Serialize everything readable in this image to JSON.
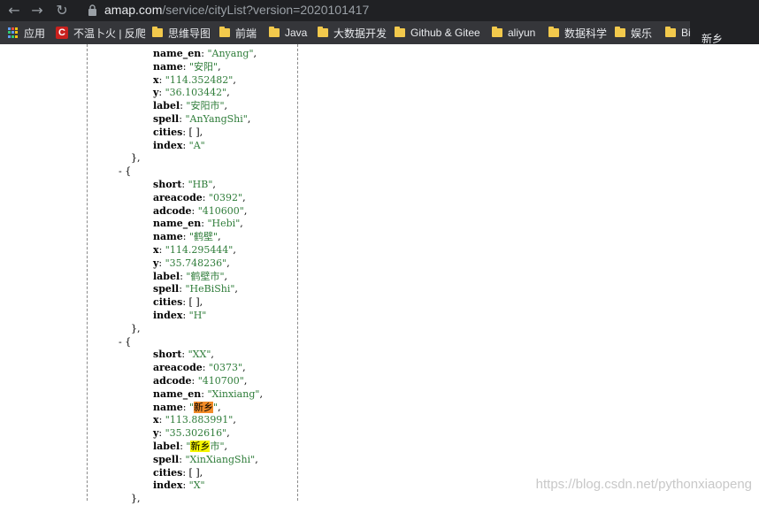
{
  "browser": {
    "url_host": "amap.com",
    "url_path": "/service/cityList?version=2020101417",
    "bookmarks": [
      {
        "label": "应用",
        "icon": "apps-grid-icon"
      },
      {
        "label": "不温卜火 | 反爬",
        "icon": "csdn-icon"
      },
      {
        "label": "思维导图",
        "icon": "folder-icon"
      },
      {
        "label": "前端",
        "icon": "folder-icon"
      },
      {
        "label": "Java",
        "icon": "folder-icon"
      },
      {
        "label": "大数据开发",
        "icon": "folder-icon"
      },
      {
        "label": "Github & Gitee",
        "icon": "folder-icon"
      },
      {
        "label": "aliyun",
        "icon": "folder-icon"
      },
      {
        "label": "数据科学",
        "icon": "folder-icon"
      },
      {
        "label": "娱乐",
        "icon": "folder-icon"
      },
      {
        "label": "Bi",
        "icon": "folder-icon"
      }
    ],
    "find_popup_text": "新乡"
  },
  "json_lines": [
    {
      "indent": 2,
      "key": "name_en",
      "value": "\"Anyang\""
    },
    {
      "indent": 2,
      "key": "name",
      "value": "\"安阳\""
    },
    {
      "indent": 2,
      "key": "x",
      "value": "\"114.352482\""
    },
    {
      "indent": 2,
      "key": "y",
      "value": "\"36.103442\""
    },
    {
      "indent": 2,
      "key": "label",
      "value": "\"安阳市\""
    },
    {
      "indent": 2,
      "key": "spell",
      "value": "\"AnYangShi\""
    },
    {
      "indent": 2,
      "key": "cities",
      "raw": "[ ],"
    },
    {
      "indent": 2,
      "key": "index",
      "value": "\"A\"",
      "last": true
    },
    {
      "indent": 1,
      "punct": "},"
    },
    {
      "indent": 0,
      "punct": "- {"
    },
    {
      "indent": 2,
      "key": "short",
      "value": "\"HB\""
    },
    {
      "indent": 2,
      "key": "areacode",
      "value": "\"0392\""
    },
    {
      "indent": 2,
      "key": "adcode",
      "value": "\"410600\""
    },
    {
      "indent": 2,
      "key": "name_en",
      "value": "\"Hebi\""
    },
    {
      "indent": 2,
      "key": "name",
      "value": "\"鹤壁\""
    },
    {
      "indent": 2,
      "key": "x",
      "value": "\"114.295444\""
    },
    {
      "indent": 2,
      "key": "y",
      "value": "\"35.748236\""
    },
    {
      "indent": 2,
      "key": "label",
      "value": "\"鹤壁市\""
    },
    {
      "indent": 2,
      "key": "spell",
      "value": "\"HeBiShi\""
    },
    {
      "indent": 2,
      "key": "cities",
      "raw": "[ ],"
    },
    {
      "indent": 2,
      "key": "index",
      "value": "\"H\"",
      "last": true
    },
    {
      "indent": 1,
      "punct": "},"
    },
    {
      "indent": 0,
      "punct": "- {"
    },
    {
      "indent": 2,
      "key": "short",
      "value": "\"XX\""
    },
    {
      "indent": 2,
      "key": "areacode",
      "value": "\"0373\""
    },
    {
      "indent": 2,
      "key": "adcode",
      "value": "\"410700\""
    },
    {
      "indent": 2,
      "key": "name_en",
      "value": "\"Xinxiang\""
    },
    {
      "indent": 2,
      "key": "name",
      "pre": "\"",
      "hl": "新乡",
      "hlclass": "hl-orange",
      "post": "\""
    },
    {
      "indent": 2,
      "key": "x",
      "value": "\"113.883991\""
    },
    {
      "indent": 2,
      "key": "y",
      "value": "\"35.302616\""
    },
    {
      "indent": 2,
      "key": "label",
      "pre": "\"",
      "hl": "新乡",
      "hlclass": "hl-yellow",
      "post": "市\""
    },
    {
      "indent": 2,
      "key": "spell",
      "value": "\"XinXiangShi\""
    },
    {
      "indent": 2,
      "key": "cities",
      "raw": "[ ],"
    },
    {
      "indent": 2,
      "key": "index",
      "value": "\"X\"",
      "last": true
    },
    {
      "indent": 1,
      "punct": "},"
    }
  ],
  "watermark": "https://blog.csdn.net/pythonxiaopeng"
}
